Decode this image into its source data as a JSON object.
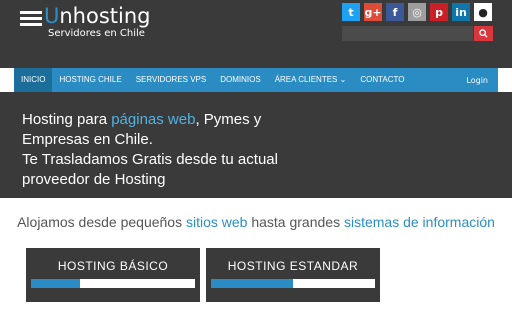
{
  "logo": {
    "title_first": "U",
    "title_rest": "nhosting",
    "subtitle": "Servidores en Chile"
  },
  "social": [
    {
      "icon": "twitter-icon",
      "glyph": "t",
      "color": "#1da1f2"
    },
    {
      "icon": "google-plus-icon",
      "glyph": "g+",
      "color": "#dd4b39"
    },
    {
      "icon": "facebook-icon",
      "glyph": "f",
      "color": "#3b5998"
    },
    {
      "icon": "instagram-icon",
      "glyph": "◎",
      "color": "#9e9e9e"
    },
    {
      "icon": "pinterest-icon",
      "glyph": "p",
      "color": "#cb2027"
    },
    {
      "icon": "linkedin-icon",
      "glyph": "in",
      "color": "#0e76a8"
    },
    {
      "icon": "github-icon",
      "glyph": "●",
      "color": "#222222"
    }
  ],
  "search": {
    "placeholder": ""
  },
  "nav": {
    "items": [
      "INICIO",
      "HOSTING CHILE",
      "SERVIDORES VPS",
      "DOMINIOS",
      "ÁREA CLIENTES",
      "CONTACTO"
    ],
    "dropdown_marker": "⌄",
    "login": "Login"
  },
  "hero": {
    "line1_pre": "Hosting para ",
    "line1_link": "páginas web",
    "line1_post": ", Pymes y Empresas en Chile.",
    "line2": "Te Trasladamos Gratis desde tu actual proveedor de Hosting"
  },
  "tagline": {
    "pre": "Alojamos desde pequeños ",
    "link1": "sitios web",
    "mid": " hasta grandes ",
    "link2": "sistemas de información"
  },
  "plans": [
    {
      "title": "HOSTING BÁSICO",
      "progress": 0.3
    },
    {
      "title": "HOSTING ESTANDAR",
      "progress": 0.5
    }
  ],
  "colors": {
    "accent": "#2b8cc4",
    "dark": "#3a3a3a",
    "search_button": "#d9363e"
  }
}
